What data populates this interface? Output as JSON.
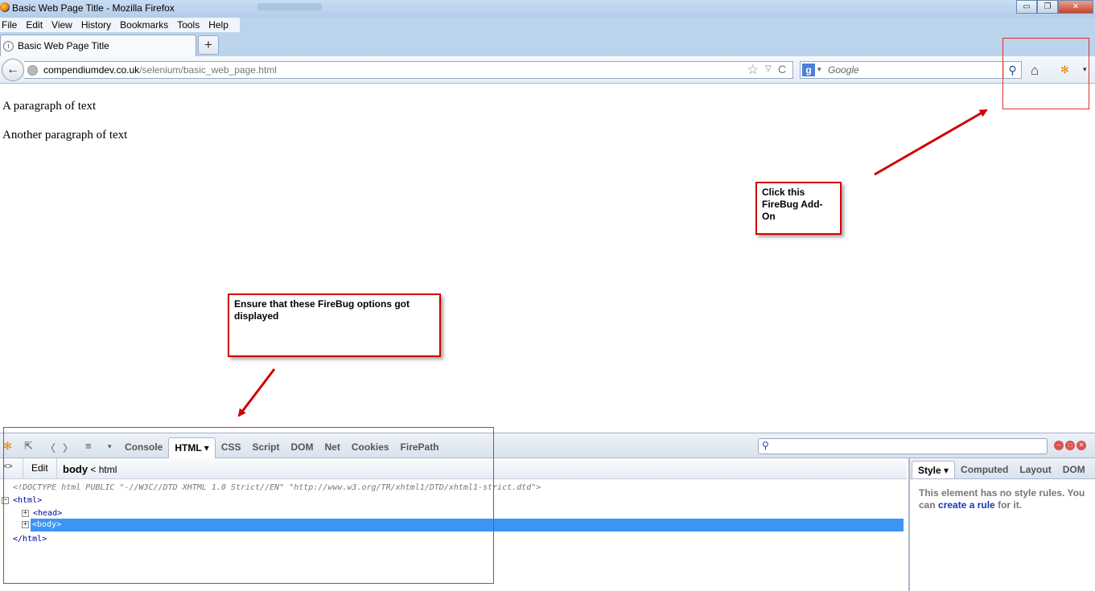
{
  "window": {
    "title": "Basic Web Page Title - Mozilla Firefox",
    "minimize_label": "▭",
    "restore_label": "❐",
    "close_label": "✕"
  },
  "menu": {
    "items": [
      "File",
      "Edit",
      "View",
      "History",
      "Bookmarks",
      "Tools",
      "Help"
    ]
  },
  "tabs": {
    "active_title": "Basic Web Page Title",
    "favicon_glyph": "i",
    "new_tab_label": "+"
  },
  "navbar": {
    "back_glyph": "←",
    "url_host": "compendiumdev.co.uk",
    "url_path": "/selenium/basic_web_page.html",
    "star_glyph": "☆",
    "drop_glyph": "▽",
    "reload_glyph": "C",
    "search_engine_letter": "g",
    "search_engine_drop_glyph": "▾",
    "search_placeholder": "Google",
    "search_btn_glyph": "⚲",
    "home_glyph": "⌂",
    "firebug_glyph": "✻",
    "menu_drop_glyph": "▾"
  },
  "page": {
    "paragraph_1": "A paragraph of text",
    "paragraph_2": "Another paragraph of text"
  },
  "annotations": {
    "callout_1": "Click this FireBug Add-On",
    "callout_2": "Ensure that these FireBug options got displayed"
  },
  "firebug": {
    "toolbar_icons": {
      "bug": "✻",
      "inspect": "⇱",
      "prev": "〈",
      "next": "〉",
      "menu": "≡",
      "drop": "▾"
    },
    "tabs": [
      "Console",
      "HTML ▾",
      "CSS",
      "Script",
      "DOM",
      "Net",
      "Cookies",
      "FirePath"
    ],
    "search_glyph": "⚲",
    "win_btns": [
      "–",
      "□",
      "✕"
    ],
    "crumbbar": {
      "inspect_icon": "<>",
      "edit_label": "Edit",
      "crumb_current": "body",
      "crumb_sep": " < ",
      "crumb_parent": "html"
    },
    "tree": {
      "doctype": "<!DOCTYPE html PUBLIC \"-//W3C//DTD XHTML 1.0 Strict//EN\" \"http://www.w3.org/TR/xhtml1/DTD/xhtml1-strict.dtd\">",
      "html_open": "<html>",
      "head": "<head>",
      "body": "<body>",
      "html_close": "</html>",
      "collapse_glyph": "−",
      "expand_glyph": "+"
    },
    "side": {
      "tabs": [
        "Style ▾",
        "Computed",
        "Layout",
        "DOM"
      ],
      "message_before": "This element has no style rules. You can ",
      "message_link": "create a rule",
      "message_after": " for it."
    }
  },
  "colors": {
    "selection": "#3b96f3",
    "annotation_red": "#d00000",
    "tag_blue": "#0000a0"
  }
}
